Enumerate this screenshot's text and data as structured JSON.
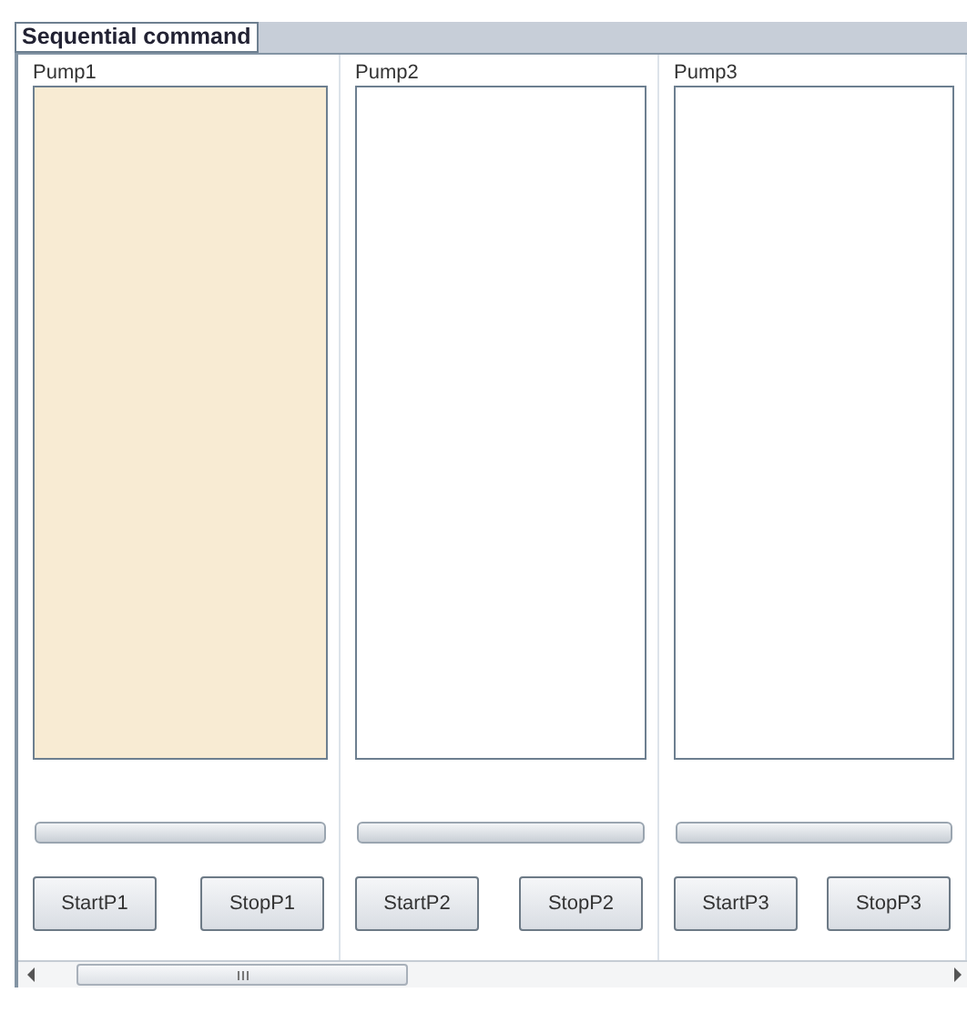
{
  "group": {
    "title": "Sequential command"
  },
  "pumps": [
    {
      "label": "Pump1",
      "highlighted": true,
      "level": 0,
      "buttons": [
        "StartP1",
        "StopP1"
      ]
    },
    {
      "label": "Pump2",
      "highlighted": false,
      "level": 0,
      "buttons": [
        "StartP2",
        "StopP2"
      ]
    },
    {
      "label": "Pump3",
      "highlighted": false,
      "level": 0,
      "buttons": [
        "StartP3",
        "StopP3"
      ]
    }
  ]
}
